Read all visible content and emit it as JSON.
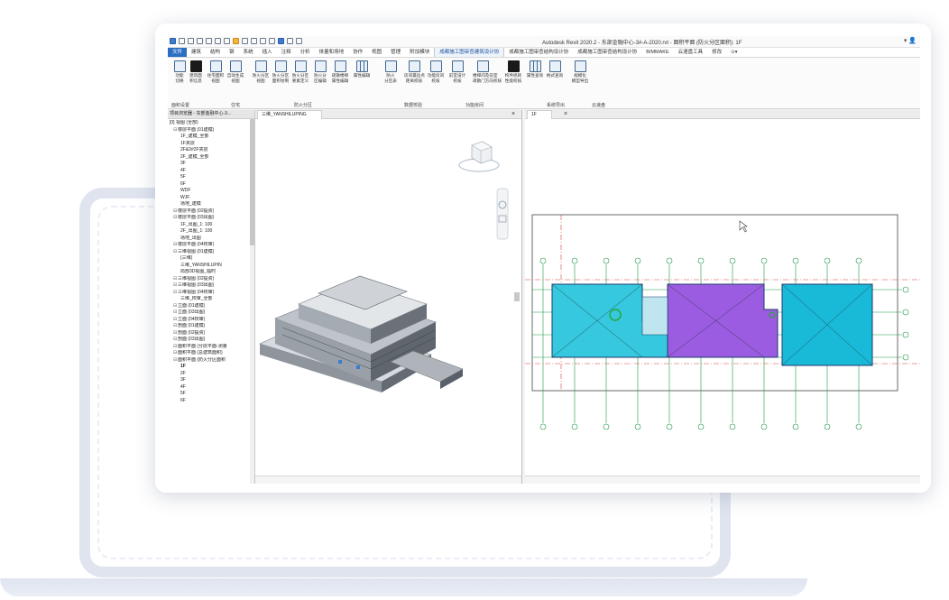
{
  "app": {
    "title": "Autodesk Revit 2020.2 - 东部金融中心-3#-A-2020.rvt - 面积平面 (防火分区面积): 1F",
    "window_controls": "▾ 👤"
  },
  "ribbon": {
    "tabs": [
      "文件",
      "建筑",
      "结构",
      "钢",
      "系统",
      "插入",
      "注释",
      "分析",
      "体量和场地",
      "协作",
      "视图",
      "管理",
      "附加模块",
      "成都施工图审查建筑设计协",
      "成都施工图审查结构设计协",
      "成都施工图审查结构设计协",
      "BIMMAKE",
      "云速盘工具",
      "修改",
      "⊙▾"
    ],
    "active_tab_index": 13,
    "buttons": [
      {
        "label": "功能\n切换"
      },
      {
        "label": "建筑面\n积信息"
      },
      {
        "label": "住宅面积\n视图"
      },
      {
        "label": "自动生成\n视图"
      },
      {
        "label": "防火分区\n视图"
      },
      {
        "label": "防火分区\n面积绘制"
      },
      {
        "label": "防火分区\n要素定义"
      },
      {
        "label": "防火分\n区编辑"
      },
      {
        "label": "疏散楼梯\n属性编辑"
      },
      {
        "label": "属性编辑"
      },
      {
        "label": "防火\n分区表"
      },
      {
        "label": "房间最远点\n距离校核"
      },
      {
        "label": "功能房间\n校核"
      },
      {
        "label": "前室设计\n校核"
      },
      {
        "label": "楼梯间及前室\n疏散门方向校核"
      },
      {
        "label": "构件损耗\n性能校核"
      },
      {
        "label": "属性查询"
      },
      {
        "label": "格式查询"
      },
      {
        "label": "规模化\n模型导出"
      }
    ],
    "groups": [
      "面积设置",
      "住宅",
      "防火分区",
      "数据校验",
      "功能房间",
      "系统导出",
      "云速盘"
    ]
  },
  "browser": {
    "title": "项目浏览器 - 东部金融中心-3...",
    "close": "×",
    "items": [
      {
        "text": "[0] 视图 (全部)",
        "level": 0
      },
      {
        "text": "楼层平面 (01建模)",
        "level": 1
      },
      {
        "text": "1F_建模_全部",
        "level": 2
      },
      {
        "text": "1F夹层",
        "level": 2
      },
      {
        "text": "2F&3#2F夹层",
        "level": 2
      },
      {
        "text": "2F_建模_全部",
        "level": 2
      },
      {
        "text": "3F",
        "level": 2
      },
      {
        "text": "4F",
        "level": 2
      },
      {
        "text": "5F",
        "level": 2
      },
      {
        "text": "6F",
        "level": 2
      },
      {
        "text": "WDF",
        "level": 2
      },
      {
        "text": "WJF",
        "level": 2
      },
      {
        "text": "场地_建模",
        "level": 2
      },
      {
        "text": "楼层平面 (02提资)",
        "level": 1
      },
      {
        "text": "楼层平面 (03出图)",
        "level": 1
      },
      {
        "text": "1F_出图_1: 100",
        "level": 2
      },
      {
        "text": "2F_出图_1: 100",
        "level": 2
      },
      {
        "text": "场地_出图",
        "level": 2
      },
      {
        "text": "楼层平面 (04校审)",
        "level": 1
      },
      {
        "text": "三维视图 (01建模)",
        "level": 1
      },
      {
        "text": "{三维}",
        "level": 2
      },
      {
        "text": "三维_YANSHILUPIN",
        "level": 2
      },
      {
        "text": "局部3D视图_临时",
        "level": 2
      },
      {
        "text": "三维视图 (02提资)",
        "level": 1
      },
      {
        "text": "三维视图 (03出图)",
        "level": 1
      },
      {
        "text": "三维视图 (04校审)",
        "level": 1
      },
      {
        "text": "三维_校审_全部",
        "level": 2
      },
      {
        "text": "立面 (01建模)",
        "level": 1
      },
      {
        "text": "立面 (03出图)",
        "level": 1
      },
      {
        "text": "立面 (04校审)",
        "level": 1
      },
      {
        "text": "剖面 (01建模)",
        "level": 1
      },
      {
        "text": "剖面 (02提资)",
        "level": 1
      },
      {
        "text": "剖面 (03出图)",
        "level": 1
      },
      {
        "text": "面积平面 (分层平面-测量",
        "level": 1
      },
      {
        "text": "面积平面 (总建筑面积)",
        "level": 1
      },
      {
        "text": "面积平面 (防火分区面积",
        "level": 1
      },
      {
        "text": "1F",
        "level": 2,
        "bold": true
      },
      {
        "text": "2F",
        "level": 2
      },
      {
        "text": "3F",
        "level": 2
      },
      {
        "text": "4F",
        "level": 2
      },
      {
        "text": "5F",
        "level": 2
      },
      {
        "text": "6F",
        "level": 2
      }
    ]
  },
  "view3d": {
    "tab": "三维_YANSHILUPING",
    "close": "×"
  },
  "viewplan": {
    "tab": "1F",
    "close": "×"
  },
  "colors": {
    "zone_cyan": "#35c8de",
    "zone_purple": "#9b5ce2",
    "zone_teal": "#19b9d8",
    "grid_green": "#1f9a45",
    "grid_red": "#d84040",
    "ribbon_file": "#2b6fc2"
  }
}
